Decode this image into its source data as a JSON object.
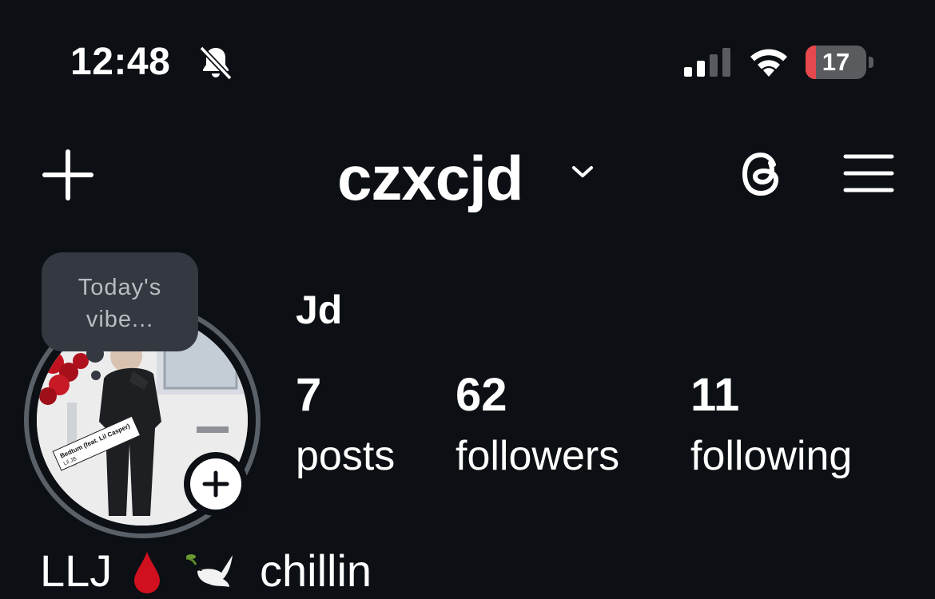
{
  "status_bar": {
    "time": "12:48",
    "battery_level": "17",
    "battery_fraction": 0.17
  },
  "header": {
    "username": "czxcjd"
  },
  "note": {
    "text_line1": "Today's",
    "text_line2": "vibe..."
  },
  "profile": {
    "display_name": "Jd",
    "stats": [
      {
        "number": "7",
        "label": "posts"
      },
      {
        "number": "62",
        "label": "followers"
      },
      {
        "number": "11",
        "label": "following"
      }
    ],
    "bio_prefix": "LLJ",
    "bio_emoji_1": "drop-of-blood",
    "bio_emoji_2": "dove-of-peace",
    "bio_text": "chillin"
  },
  "avatar_sticker": {
    "song_title": "Bedtum (feat. Lil Casper)",
    "artist": "Lil JB"
  },
  "colors": {
    "background": "#0c0f14",
    "text": "#ffffff",
    "ring": "#5a6068",
    "note_bg": "#343841",
    "battery_low": "#e5484d"
  }
}
